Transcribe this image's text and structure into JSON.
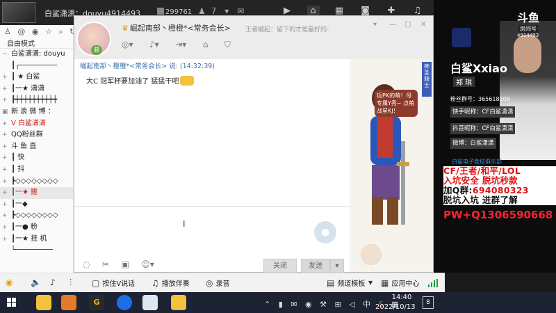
{
  "topbar": {
    "title": "白鲨潇潇：douyu4914493",
    "online": "299761",
    "count": "7"
  },
  "left_panel": {
    "mode": "自由模式",
    "channels": [
      {
        "tag": "−",
        "label": "白鲨潇潇: douyu",
        "hl": false,
        "red": false
      },
      {
        "tag": "",
        "label": "┃┌─────────",
        "hl": false,
        "red": false
      },
      {
        "tag": "+",
        "label": "┃  ★  白鲨",
        "hl": false,
        "red": false
      },
      {
        "tag": "+",
        "label": "┃一★  潇潇",
        "hl": false,
        "red": false
      },
      {
        "tag": "+",
        "label": "┣┿┿┿┿┿┿┿┿┿┿",
        "hl": false,
        "red": false
      },
      {
        "tag": "▣",
        "label": "新 浪 微 博 ：",
        "hl": false,
        "red": false
      },
      {
        "tag": "+",
        "label": "V 白鲨潇潇",
        "hl": false,
        "red": true
      },
      {
        "tag": "+",
        "label": "  QQ粉丝群",
        "hl": false,
        "red": false
      },
      {
        "tag": "+",
        "label": "  斗 鱼 直",
        "hl": false,
        "red": false
      },
      {
        "tag": "+",
        "label": "┃        快",
        "hl": false,
        "red": false
      },
      {
        "tag": "+",
        "label": "┃           抖",
        "hl": false,
        "red": false
      },
      {
        "tag": "+",
        "label": "┣◇◇◇◇◇◇◇◇",
        "hl": false,
        "red": false
      },
      {
        "tag": "+",
        "label": "┃一★       搓",
        "hl": true,
        "red": true
      },
      {
        "tag": "+",
        "label": "┃一◆",
        "hl": false,
        "red": false
      },
      {
        "tag": "+",
        "label": "┣◇◇◇◇◇◇◇◇",
        "hl": false,
        "red": false
      },
      {
        "tag": "+",
        "label": "┃一●     粉",
        "hl": false,
        "red": false
      },
      {
        "tag": "+",
        "label": "┃一★  挂 机",
        "hl": false,
        "red": false
      },
      {
        "tag": "",
        "label": "└─────────",
        "hl": false,
        "red": false
      }
    ]
  },
  "chat": {
    "group_name": "崛起南部丶橙橙*<常务会长>",
    "signature": "王者崛起：留下的才是最好的-",
    "message": {
      "header": "崛起南部丶橙橙*<常务会长> 说: ",
      "time": "(14:32:39)",
      "text": "大C 冠军杯要加油了 猛猛干吧"
    },
    "close_label": "关闭",
    "send_label": "发送",
    "bubble_text": "玩PK的萌！母专属Y秀~ 点萌战星KJ！",
    "badge_text": "神圣骑士",
    "level": "叔"
  },
  "stream": {
    "brand": "斗鱼",
    "room_label": "房间号",
    "room_id": "4914493",
    "streamer": "白鲨Xxiao",
    "real_name": "郑 琪",
    "fan_group": "粉丝群号：365618108",
    "kuaishou": "快手昵称：CF白鲨潇潇",
    "douyin": "抖音昵称：CF白鲨潇潇",
    "weibo": "微博：白鲨潇潇",
    "club": "白鲨电子竞技俱乐部",
    "promo_line1": "CF/王者/和平/LOL",
    "promo_line2": "入坑安全 脱坑秒款",
    "promo_line3_prefix": "加Q群:",
    "promo_line3_num": "694080323",
    "promo_line4": "脱坑入坑 进群了解",
    "pw": "PW+Q1306590668"
  },
  "voicebar": {
    "talk_label": "按住V说话",
    "music_label": "播放伴奏",
    "record_label": "录音",
    "template_label": "频道模板",
    "app_center": "应用中心"
  },
  "taskbar": {
    "time": "14:40",
    "date": "2022/10/13",
    "notifications": "8",
    "ime": "中"
  }
}
